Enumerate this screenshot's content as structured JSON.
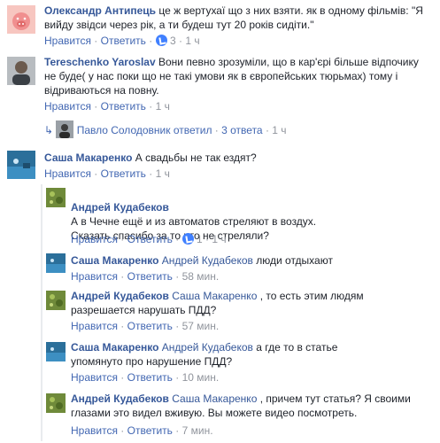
{
  "labels": {
    "like": "Нравится",
    "reply": "Ответить",
    "sep": "·"
  },
  "comments": [
    {
      "name": "Олександр Антипець",
      "text": "це ж вертухаї що з них взяти. як в одному фільмів: \"Я вийду звідси через рік, а ти будеш тут 20 років сидіти.\"",
      "likes": "3",
      "time": "1 ч"
    },
    {
      "name": "Tereschenko Yaroslav",
      "text": "Вони певно зрозуміли, що в кар'єрі більше відпочику не буде( у нас поки що не такі умови як в європейських тюрьмах) тому і відриваються на повну.",
      "time": "1 ч",
      "replies_summary": {
        "name": "Павло Солодовник",
        "action": "ответил",
        "count": "3 ответа",
        "time": "1 ч"
      }
    },
    {
      "name": "Саша Макаренко",
      "text": "А свадьбы не так ездят?",
      "time": "1 ч"
    }
  ],
  "replies": [
    {
      "name": "Андрей Кудабеков",
      "reply_to": "",
      "text": "А в Чечне ещё и из автоматов стреляют в воздух.\nСказать спасибо за то что не стреляли?",
      "likes": "1",
      "time": "1 ч"
    },
    {
      "name": "Саша Макаренко",
      "reply_to": "Андрей Кудабеков",
      "text": "люди отдыхают",
      "time": "58 мин."
    },
    {
      "name": "Андрей Кудабеков",
      "reply_to": "Саша Макаренко",
      "text": ", то есть этим людям разрешается нарушать ПДД?",
      "time": "57 мин."
    },
    {
      "name": "Саша Макаренко",
      "reply_to": "Андрей Кудабеков",
      "text": "а где то в статье упомянуто про нарушение ПДД?",
      "time": "10 мин."
    },
    {
      "name": "Андрей Кудабеков",
      "reply_to": "Саша Макаренко",
      "text": ", причем тут статья? Я своими глазами это видел вживую. Вы можете видео посмотреть.",
      "time": "7 мин."
    }
  ]
}
